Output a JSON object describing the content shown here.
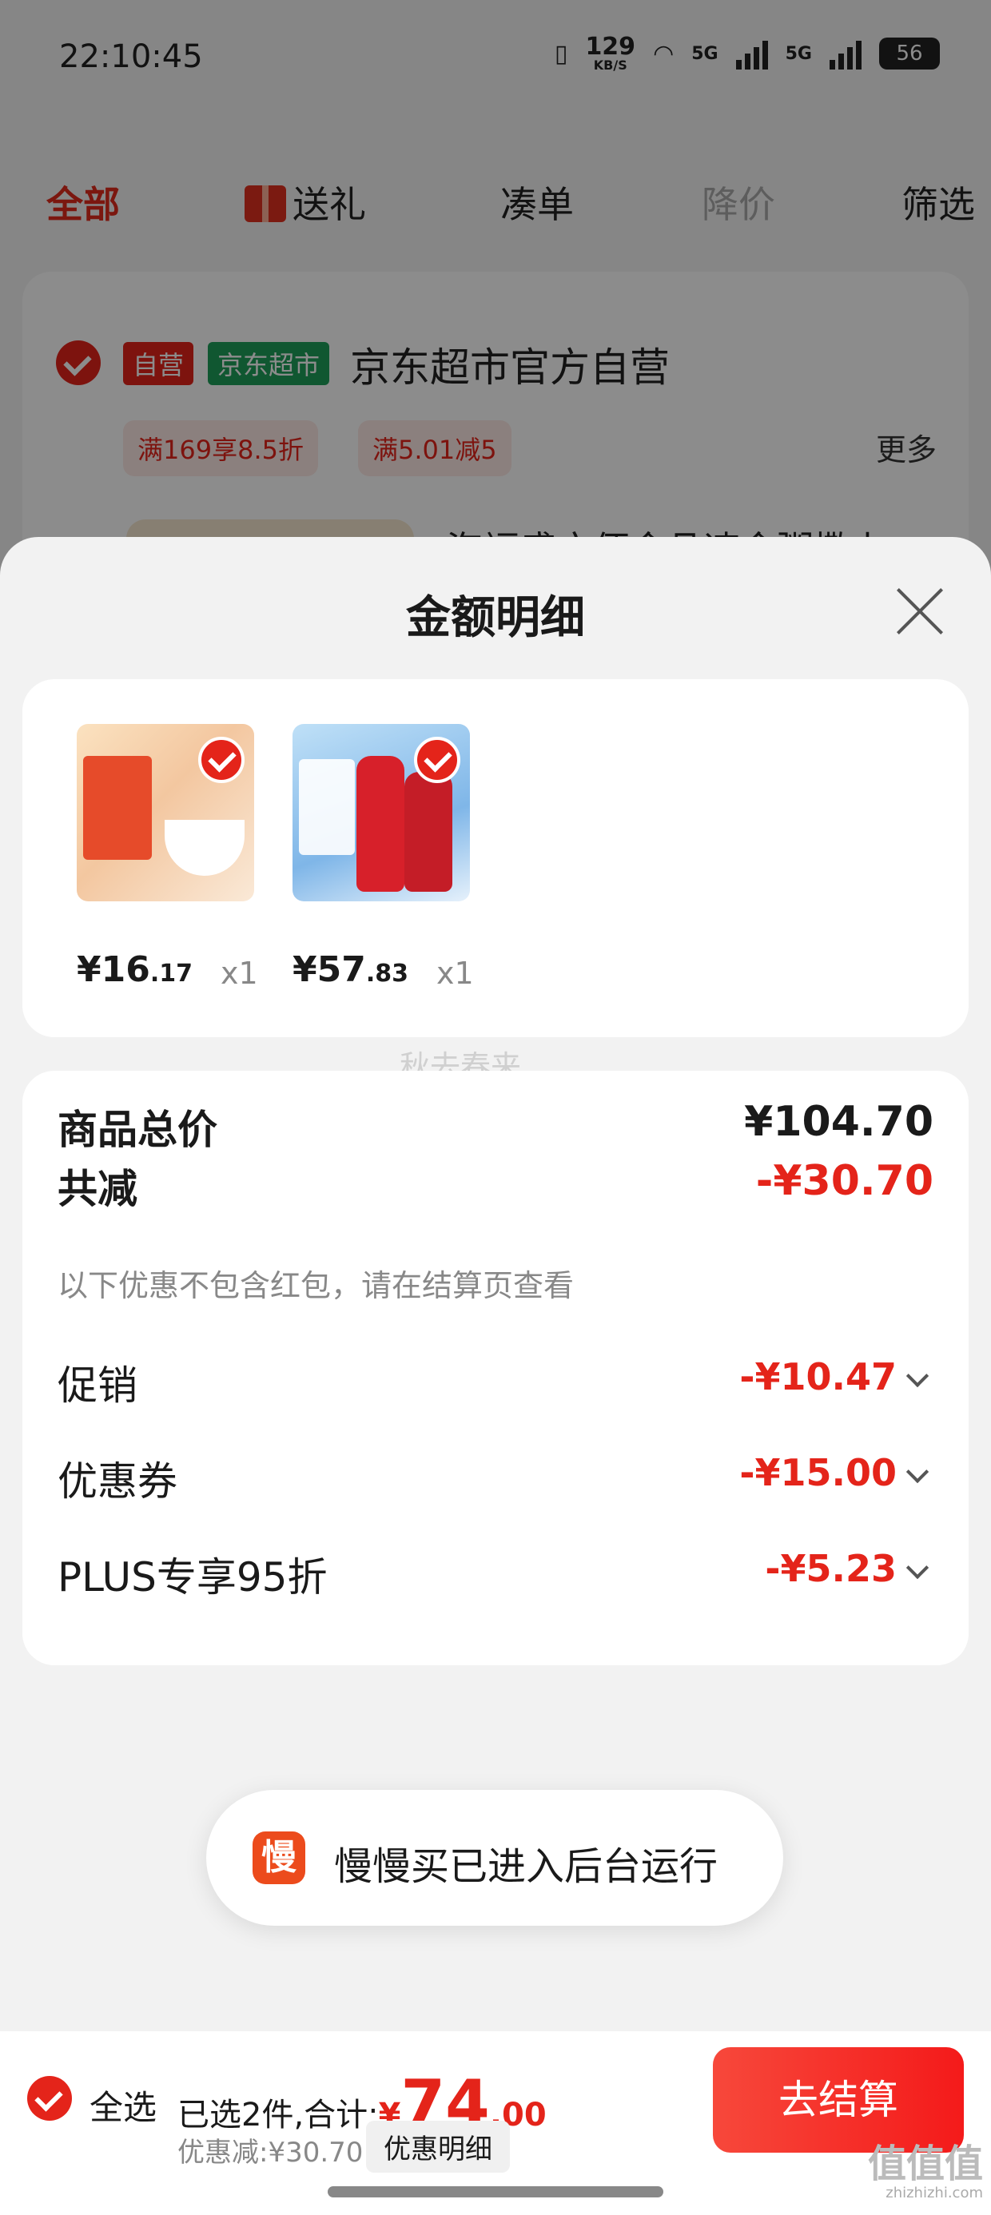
{
  "status_bar": {
    "time": "22:10:45",
    "net_speed_value": "129",
    "net_speed_unit": "KB/S",
    "signal1_label": "5G",
    "signal2_label": "5G",
    "battery": "56"
  },
  "filter_tabs": [
    {
      "label": "全部",
      "state": "active"
    },
    {
      "label": "送礼",
      "icon": "gift-icon"
    },
    {
      "label": "凑单"
    },
    {
      "label": "降价",
      "state": "disabled"
    },
    {
      "label": "筛选"
    }
  ],
  "shop": {
    "tag_self": "自营",
    "tag_store": "京东超市",
    "name": "京东超市官方自营",
    "promos": [
      "满169享8.5折",
      "满5.01减5"
    ],
    "more": "更多",
    "first_item_title": "海福盛方便食品速食粥撒上"
  },
  "sheet": {
    "title": "金额明细",
    "products": [
      {
        "price_int": "¥16",
        "price_dec": ".17",
        "qty": "x1"
      },
      {
        "price_int": "¥57",
        "price_dec": ".83",
        "qty": "x1"
      }
    ],
    "watermark": "秋去春来",
    "total_label": "商品总价",
    "total_value": "¥104.70",
    "reduce_label": "共减",
    "reduce_value": "-¥30.70",
    "note": "以下优惠不包含红包，请在结算页查看",
    "discounts": [
      {
        "label": "促销",
        "value": "-¥10.47"
      },
      {
        "label": "优惠券",
        "value": "-¥15.00"
      },
      {
        "label": "PLUS专享95折",
        "value": "-¥5.23"
      }
    ]
  },
  "toast": {
    "icon_char": "慢",
    "text": "慢慢买已进入后台运行"
  },
  "bottom_bar": {
    "select_all": "全选",
    "selected_prefix": "已选2件,合计:",
    "currency": "¥",
    "total_int": "74",
    "total_dec": ".00",
    "discount_text": "优惠减:¥30.70",
    "detail_button": "优惠明细",
    "checkout": "去结算",
    "corner_logo": "值值值",
    "corner_url": "zhizhizhi.com"
  },
  "colors": {
    "accent": "#e4241a",
    "store_tag": "#1e9e5a"
  }
}
